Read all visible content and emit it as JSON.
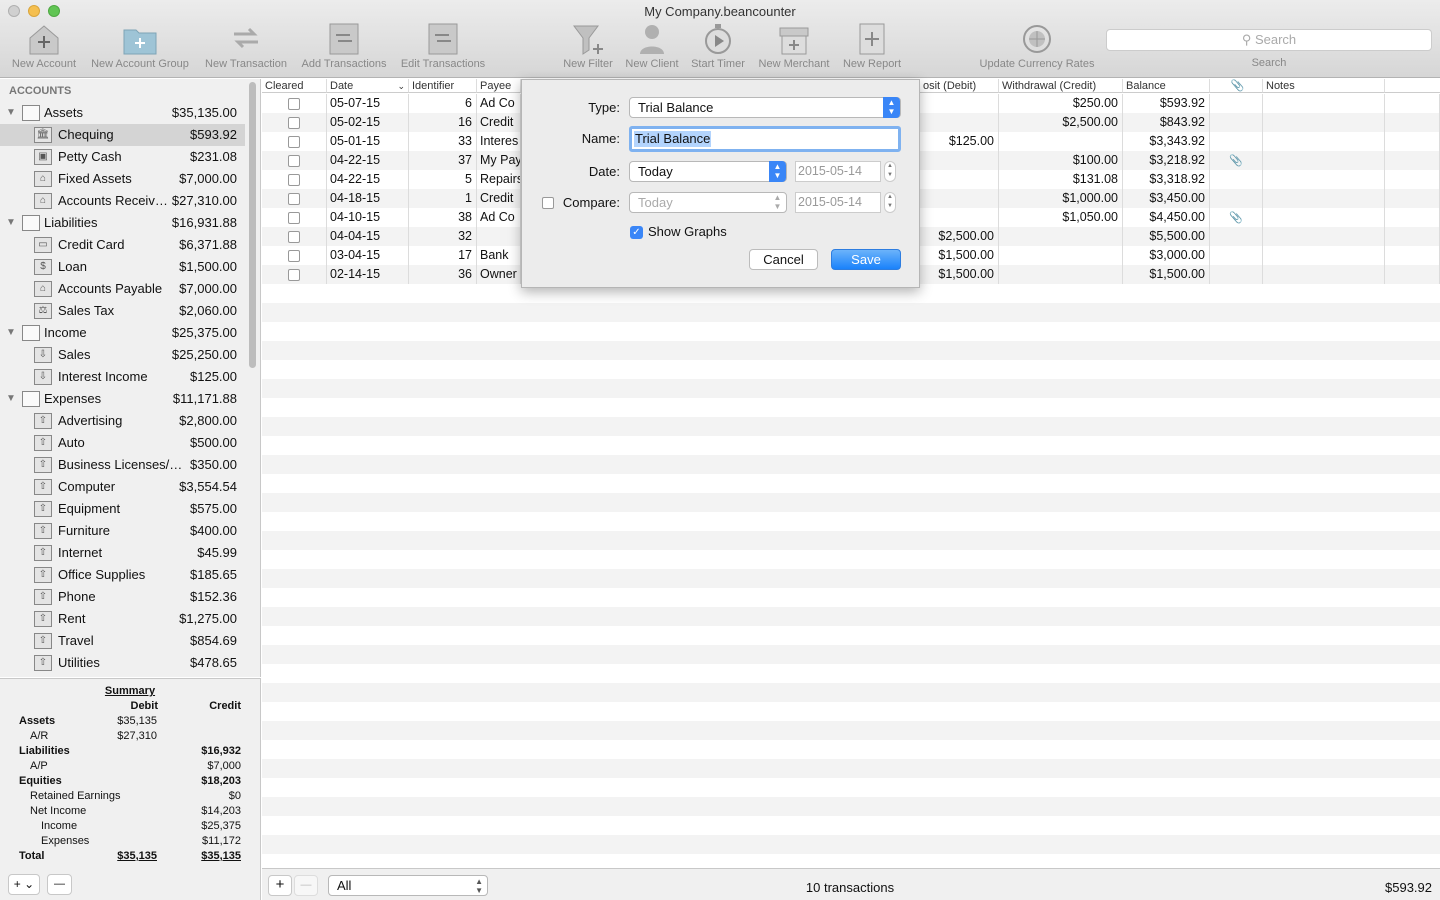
{
  "window": {
    "title": "My Company.beancounter"
  },
  "toolbar": {
    "new_account": "New Account",
    "new_account_group": "New Account Group",
    "new_transaction": "New Transaction",
    "add_transactions": "Add Transactions",
    "edit_transactions": "Edit Transactions",
    "new_filter": "New Filter",
    "new_client": "New Client",
    "start_timer": "Start Timer",
    "new_merchant": "New Merchant",
    "new_report": "New Report",
    "update_currency_rates": "Update Currency Rates",
    "search_placeholder": "Search",
    "search_label": "Search"
  },
  "sidebar": {
    "header": "ACCOUNTS",
    "accounts": [
      {
        "name": "Assets",
        "amount": "$35,135.00",
        "group": true,
        "icon": "folder-icon"
      },
      {
        "name": "Chequing",
        "amount": "$593.92",
        "icon": "bank-icon",
        "selected": true
      },
      {
        "name": "Petty Cash",
        "amount": "$231.08",
        "icon": "cash-icon"
      },
      {
        "name": "Fixed Assets",
        "amount": "$7,000.00",
        "icon": "house-icon"
      },
      {
        "name": "Accounts Receiv…",
        "amount": "$27,310.00",
        "icon": "house-icon"
      },
      {
        "name": "Liabilities",
        "amount": "$16,931.88",
        "group": true,
        "icon": "folder-icon"
      },
      {
        "name": "Credit Card",
        "amount": "$6,371.88",
        "icon": "credit-card-icon"
      },
      {
        "name": "Loan",
        "amount": "$1,500.00",
        "icon": "dollar-icon"
      },
      {
        "name": "Accounts Payable",
        "amount": "$7,000.00",
        "icon": "house-icon"
      },
      {
        "name": "Sales Tax",
        "amount": "$2,060.00",
        "icon": "scale-icon"
      },
      {
        "name": "Income",
        "amount": "$25,375.00",
        "group": true,
        "icon": "folder-icon"
      },
      {
        "name": "Sales",
        "amount": "$25,250.00",
        "icon": "income-icon"
      },
      {
        "name": "Interest Income",
        "amount": "$125.00",
        "icon": "income-icon"
      },
      {
        "name": "Expenses",
        "amount": "$11,171.88",
        "group": true,
        "icon": "folder-icon"
      },
      {
        "name": "Advertising",
        "amount": "$2,800.00",
        "icon": "expense-icon"
      },
      {
        "name": "Auto",
        "amount": "$500.00",
        "icon": "expense-icon"
      },
      {
        "name": "Business Licenses/…",
        "amount": "$350.00",
        "icon": "expense-icon"
      },
      {
        "name": "Computer",
        "amount": "$3,554.54",
        "icon": "expense-icon"
      },
      {
        "name": "Equipment",
        "amount": "$575.00",
        "icon": "expense-icon"
      },
      {
        "name": "Furniture",
        "amount": "$400.00",
        "icon": "expense-icon"
      },
      {
        "name": "Internet",
        "amount": "$45.99",
        "icon": "expense-icon"
      },
      {
        "name": "Office Supplies",
        "amount": "$185.65",
        "icon": "expense-icon"
      },
      {
        "name": "Phone",
        "amount": "$152.36",
        "icon": "expense-icon"
      },
      {
        "name": "Rent",
        "amount": "$1,275.00",
        "icon": "expense-icon"
      },
      {
        "name": "Travel",
        "amount": "$854.69",
        "icon": "expense-icon"
      },
      {
        "name": "Utilities",
        "amount": "$478.65",
        "icon": "expense-icon"
      }
    ]
  },
  "summary": {
    "title": "Summary",
    "debit": "Debit",
    "credit": "Credit",
    "rows": [
      {
        "label": "Assets",
        "debit": "$35,135",
        "credit": "",
        "bold": true,
        "indent": 0
      },
      {
        "label": "A/R",
        "debit": "$27,310",
        "credit": "",
        "bold": false,
        "indent": 1
      },
      {
        "label": "Liabilities",
        "debit": "",
        "credit": "$16,932",
        "bold": true,
        "indent": 0
      },
      {
        "label": "A/P",
        "debit": "",
        "credit": "$7,000",
        "bold": false,
        "indent": 1
      },
      {
        "label": "Equities",
        "debit": "",
        "credit": "$18,203",
        "bold": true,
        "indent": 0
      },
      {
        "label": "Retained Earnings",
        "debit": "",
        "credit": "$0",
        "bold": false,
        "indent": 1
      },
      {
        "label": "Net Income",
        "debit": "",
        "credit": "$14,203",
        "bold": false,
        "indent": 1
      },
      {
        "label": "Income",
        "debit": "",
        "credit": "$25,375",
        "bold": false,
        "indent": 2
      },
      {
        "label": "Expenses",
        "debit": "",
        "credit": "$11,172",
        "bold": false,
        "indent": 2
      },
      {
        "label": "Total",
        "debit": "$35,135",
        "credit": "$35,135",
        "bold": true,
        "indent": 0,
        "total": true
      }
    ]
  },
  "table": {
    "columns": {
      "cleared": "Cleared",
      "date": "Date",
      "identifier": "Identifier",
      "payee": "Payee",
      "deposit": "osit (Debit)",
      "withdrawal": "Withdrawal (Credit)",
      "balance": "Balance",
      "notes": "Notes"
    },
    "rows": [
      {
        "date": "05-07-15",
        "id": "6",
        "payee": "Ad Co",
        "deposit": "",
        "withdrawal": "$250.00",
        "balance": "$593.92",
        "attach": false
      },
      {
        "date": "05-02-15",
        "id": "16",
        "payee": "Credit",
        "deposit": "",
        "withdrawal": "$2,500.00",
        "balance": "$843.92",
        "attach": false
      },
      {
        "date": "05-01-15",
        "id": "33",
        "payee": "Interes",
        "deposit": "$125.00",
        "withdrawal": "",
        "balance": "$3,343.92",
        "attach": false
      },
      {
        "date": "04-22-15",
        "id": "37",
        "payee": "My Pay",
        "deposit": "",
        "withdrawal": "$100.00",
        "balance": "$3,218.92",
        "attach": true
      },
      {
        "date": "04-22-15",
        "id": "5",
        "payee": "Repairs",
        "deposit": "",
        "withdrawal": "$131.08",
        "balance": "$3,318.92",
        "attach": false
      },
      {
        "date": "04-18-15",
        "id": "1",
        "payee": "Credit",
        "deposit": "",
        "withdrawal": "$1,000.00",
        "balance": "$3,450.00",
        "attach": false
      },
      {
        "date": "04-10-15",
        "id": "38",
        "payee": "Ad Co",
        "deposit": "",
        "withdrawal": "$1,050.00",
        "balance": "$4,450.00",
        "attach": true
      },
      {
        "date": "04-04-15",
        "id": "32",
        "payee": "",
        "deposit": "$2,500.00",
        "withdrawal": "",
        "balance": "$5,500.00",
        "attach": false
      },
      {
        "date": "03-04-15",
        "id": "17",
        "payee": "Bank",
        "deposit": "$1,500.00",
        "withdrawal": "",
        "balance": "$3,000.00",
        "attach": false
      },
      {
        "date": "02-14-15",
        "id": "36",
        "payee": "Owner",
        "deposit": "$1,500.00",
        "withdrawal": "",
        "balance": "$1,500.00",
        "attach": false
      }
    ]
  },
  "footer": {
    "filter": "All",
    "count": "10 transactions",
    "balance": "$593.92",
    "add": "+",
    "remove": "—",
    "sb_add": "+ ⌄",
    "sb_remove": "—"
  },
  "dialog": {
    "type_label": "Type:",
    "type_value": "Trial Balance",
    "name_label": "Name:",
    "name_value": "Trial Balance",
    "date_label": "Date:",
    "date_value": "Today",
    "date_field": "2015-05-14",
    "compare_label": "Compare:",
    "compare_value": "Today",
    "compare_field": "2015-05-14",
    "show_graphs": "Show Graphs",
    "cancel": "Cancel",
    "save": "Save"
  },
  "colors": {
    "accent": "#3a86f7",
    "selection": "#d4d4d4"
  }
}
